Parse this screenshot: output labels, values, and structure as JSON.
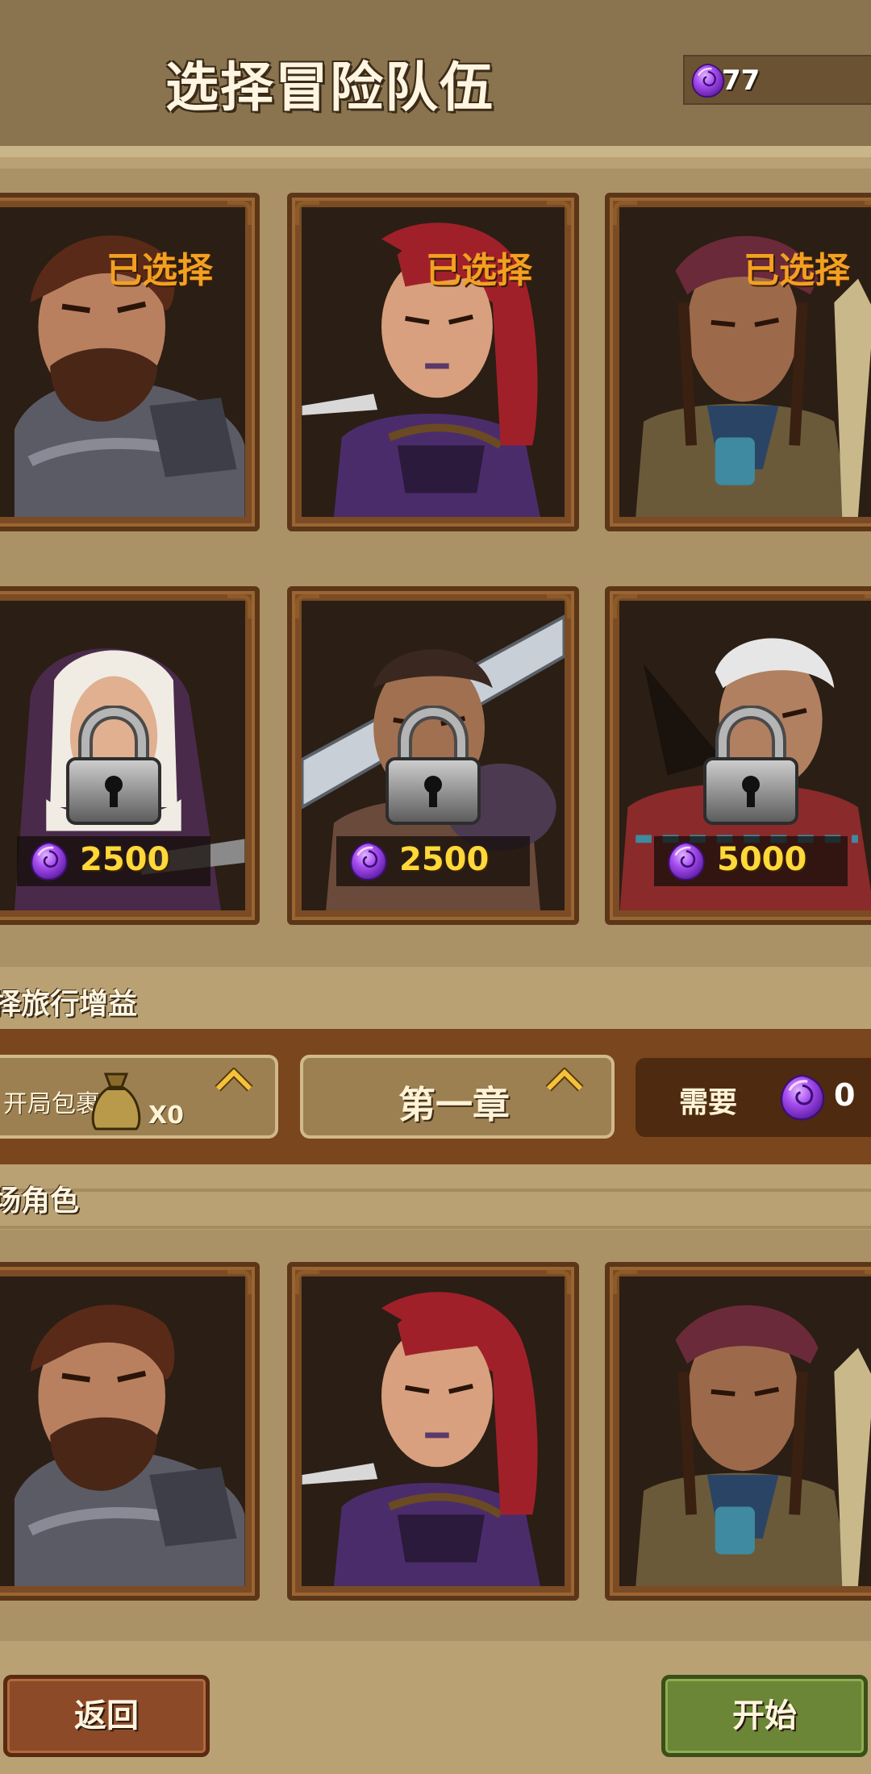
{
  "header": {
    "title": "选择冒险队伍",
    "currency_icon": "purple-gem-icon",
    "currency_value": "77"
  },
  "heroes": [
    {
      "name": "warrior",
      "status": "已选择",
      "locked": false
    },
    {
      "name": "rogue",
      "status": "已选择",
      "locked": false
    },
    {
      "name": "shaman",
      "status": "已选择",
      "locked": false
    },
    {
      "name": "nun",
      "locked": true,
      "price": "2500"
    },
    {
      "name": "swordsman",
      "locked": true,
      "price": "2500"
    },
    {
      "name": "mage",
      "locked": true,
      "price": "5000"
    }
  ],
  "travel": {
    "section_title": "择旅行增益",
    "pack_label": "开局包裹",
    "pack_count": "X0",
    "chapter": "第一章",
    "cost_label": "需要",
    "cost_value": "0"
  },
  "lineup": {
    "section_title": "场角色",
    "members": [
      "warrior",
      "rogue",
      "shaman"
    ]
  },
  "buttons": {
    "back": "返回",
    "start": "开始"
  },
  "colors": {
    "background": "#b9a173",
    "header": "#8a744f",
    "card_frame": "#7a4b24",
    "selected_text": "#f3a021",
    "price_text": "#ffd83a",
    "gem": "#8b3fd6",
    "back_button": "#8d4a28",
    "start_button": "#6a8636"
  }
}
